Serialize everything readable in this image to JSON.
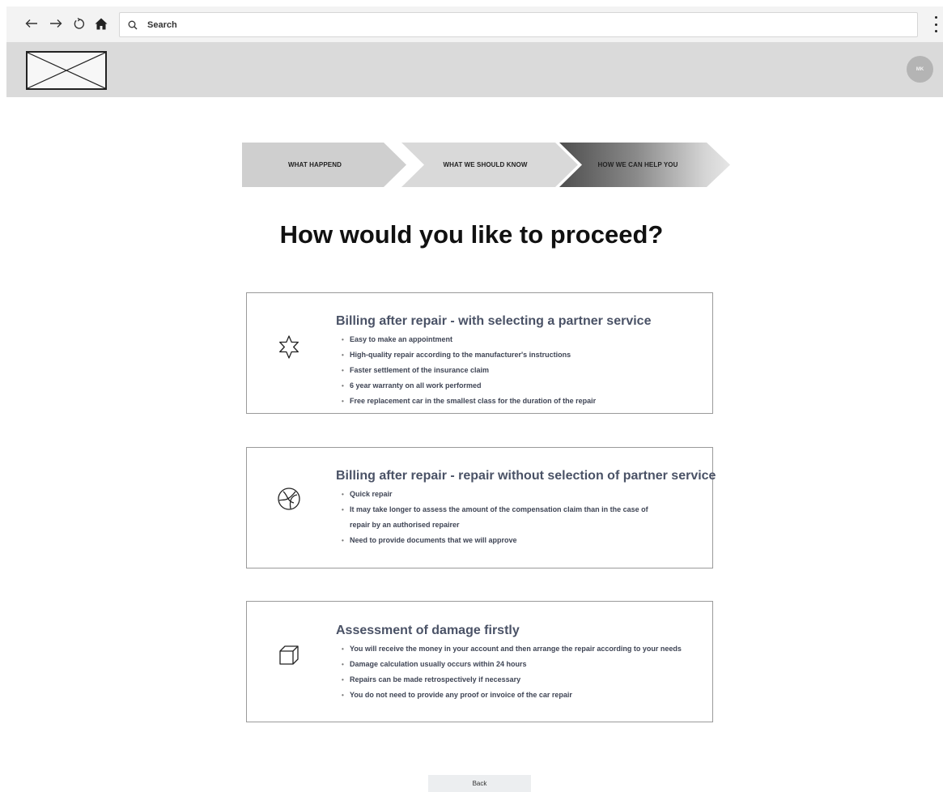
{
  "browser": {
    "back_icon": "arrow-left-icon",
    "forward_icon": "arrow-right-icon",
    "reload_icon": "reload-icon",
    "home_icon": "home-icon",
    "search_placeholder": "Search",
    "menu_icon": "kebab-menu-icon"
  },
  "header": {
    "logo": "placeholder-image-logo",
    "avatar_initials": "MK"
  },
  "stepper": {
    "steps": [
      {
        "label": "WHAT HAPPEND",
        "state": "done"
      },
      {
        "label": "WHAT WE SHOULD KNOW",
        "state": "done"
      },
      {
        "label": "HOW WE CAN HELP YOU",
        "state": "active"
      }
    ]
  },
  "main": {
    "title": "How would you like to proceed?",
    "options": [
      {
        "icon": "star-icon",
        "title": "Billing after repair  - with selecting a partner service",
        "bullets": [
          "Easy to make an appointment",
          "High-quality repair according to the manufacturer's instructions",
          "Faster settlement of the insurance claim",
          "6 year warranty on all work performed",
          "Free replacement car in the smallest class for the duration of the repair"
        ]
      },
      {
        "icon": "aperture-icon",
        "title": "Billing after repair  - repair without selection of partner service",
        "bullets": [
          "Quick repair",
          "It may take longer to assess the amount of the compensation claim than in the case of",
          "repair by an authorised repairer",
          "Need to provide documents that we will approve"
        ]
      },
      {
        "icon": "cube-icon",
        "title": "Assessment of damage firstly",
        "bullets": [
          "You will receive the money in your account and then arrange the repair according to your needs",
          "Damage calculation usually occurs within 24 hours",
          "Repairs can be made retrospectively if necessary",
          "You do not need to provide any proof or invoice of the car repair"
        ]
      }
    ]
  },
  "footer": {
    "back_label": "Back"
  }
}
